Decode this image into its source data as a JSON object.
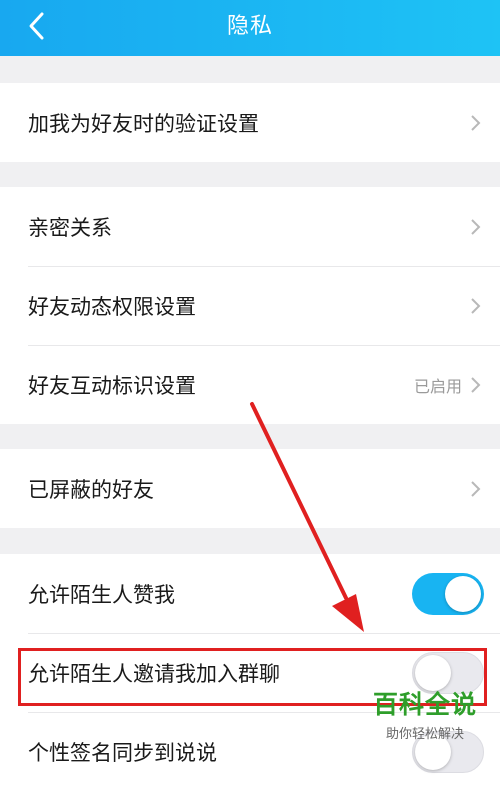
{
  "header": {
    "title": "隐私"
  },
  "groups": {
    "g1": {
      "items": [
        {
          "label": "加我为好友时的验证设置"
        }
      ]
    },
    "g2": {
      "items": [
        {
          "label": "亲密关系"
        },
        {
          "label": "好友动态权限设置"
        },
        {
          "label": "好友互动标识设置",
          "status": "已启用"
        }
      ]
    },
    "g3": {
      "items": [
        {
          "label": "已屏蔽的好友"
        }
      ]
    },
    "g4": {
      "items": [
        {
          "label": "允许陌生人赞我",
          "toggle": "on"
        },
        {
          "label": "允许陌生人邀请我加入群聊",
          "toggle": "off"
        },
        {
          "label": "个性签名同步到说说"
        }
      ]
    }
  },
  "watermark": {
    "title": "百科全说",
    "subtitle": "助你轻松解决"
  },
  "colors": {
    "header": "#1ab4f2",
    "toggle_on": "#18b4f2",
    "annotation": "#e02020",
    "watermark": "#2e9e2a"
  }
}
